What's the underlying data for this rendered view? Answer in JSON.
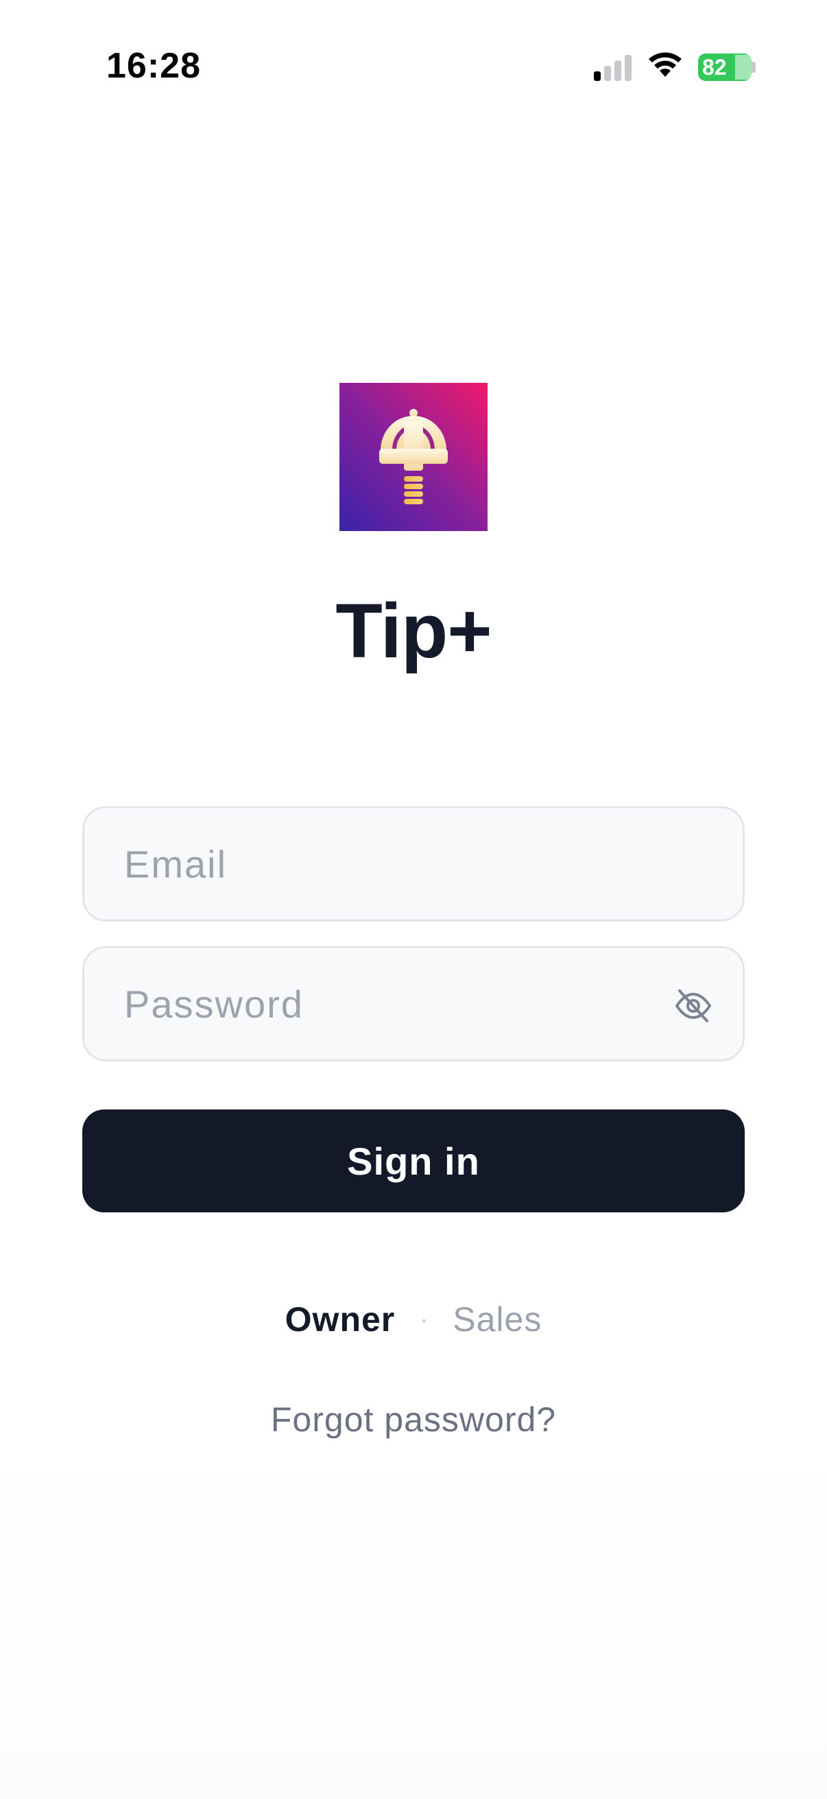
{
  "status_bar": {
    "time": "16:28",
    "battery_level": "82",
    "signal_icon": "cellular-signal-icon",
    "wifi_icon": "wifi-icon",
    "battery_color": "#34c759"
  },
  "app": {
    "logo_icon": "tip-plus-logo-icon",
    "title": "Tip+"
  },
  "login_form": {
    "email_placeholder": "Email",
    "email_value": "",
    "password_placeholder": "Password",
    "password_value": "",
    "password_toggle_icon": "eye-off-icon",
    "sign_in_label": "Sign in"
  },
  "roles": {
    "owner_label": "Owner",
    "separator": "·",
    "sales_label": "Sales",
    "selected": "Owner"
  },
  "forgot_password_label": "Forgot password?",
  "colors": {
    "primary_dark": "#131929",
    "logo_gradient_start": "#3b23a9",
    "logo_gradient_end": "#ef1a6c",
    "placeholder": "#9da2ad",
    "muted_text": "#6b7180"
  }
}
